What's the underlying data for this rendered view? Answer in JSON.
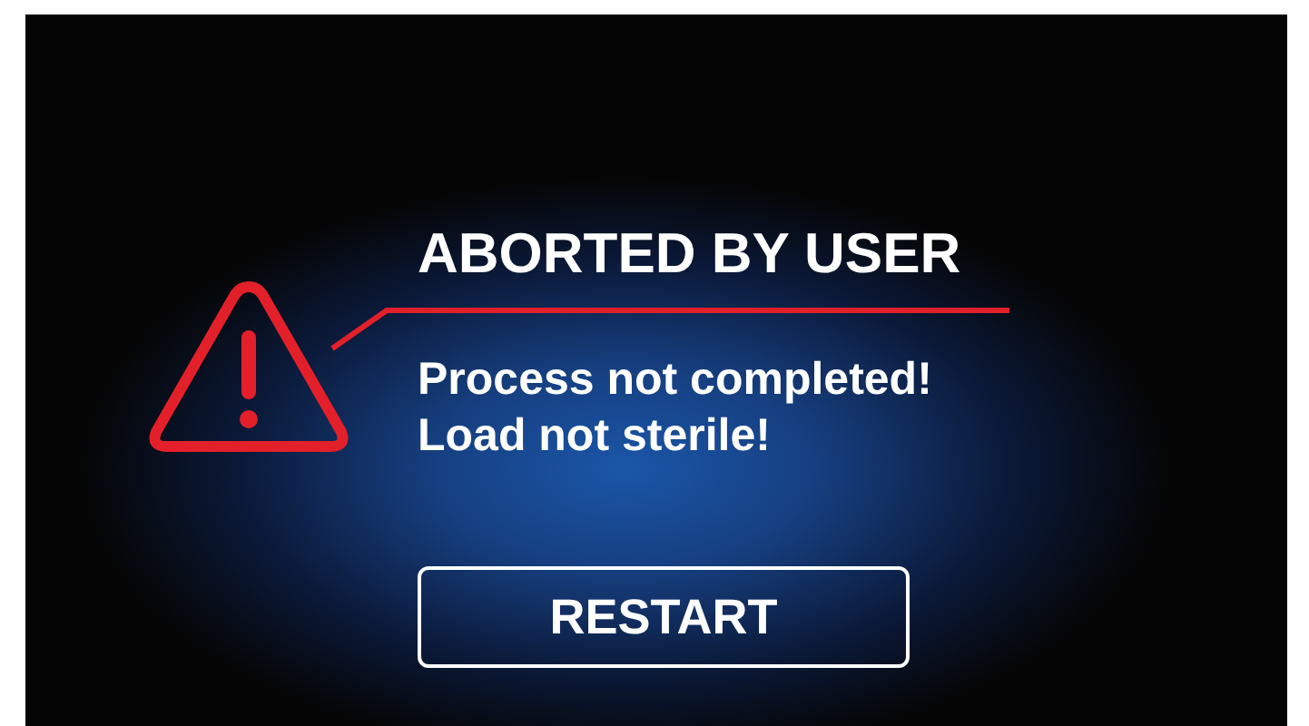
{
  "title": "ABORTED BY USER",
  "messages": [
    "Process not completed!",
    "Load not sterile!"
  ],
  "button": {
    "label": "RESTART"
  }
}
